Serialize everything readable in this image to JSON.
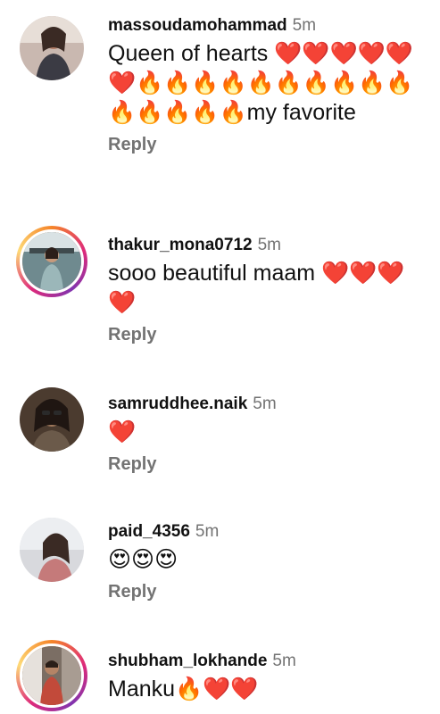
{
  "comments": [
    {
      "username": "massoudamohammad",
      "time": "5m",
      "text": "Queen of hearts ❤️❤️❤️❤️❤️❤️🔥🔥🔥🔥🔥🔥🔥🔥🔥🔥🔥🔥🔥🔥🔥my favorite",
      "reply_label": "Reply",
      "story_ring": false
    },
    {
      "username": "thakur_mona0712",
      "time": "5m",
      "text": "sooo beautiful maam ❤️❤️❤️❤️",
      "reply_label": "Reply",
      "story_ring": true
    },
    {
      "username": "samruddhee.naik",
      "time": "5m",
      "text": "❤️",
      "reply_label": "Reply",
      "story_ring": false
    },
    {
      "username": "paid_4356",
      "time": "5m",
      "text": "😍😍😍",
      "reply_label": "Reply",
      "story_ring": false
    },
    {
      "username": "shubham_lokhande",
      "time": "5m",
      "text": "Manku🔥❤️❤️",
      "reply_label": "Reply",
      "story_ring": true
    }
  ],
  "colors": {
    "secondary_text": "#737373",
    "primary_text": "#111111",
    "story_ring_start": "#f58529",
    "story_ring_end": "#dd2a7b"
  },
  "icons": {
    "avatar": "user-avatar-photo"
  }
}
